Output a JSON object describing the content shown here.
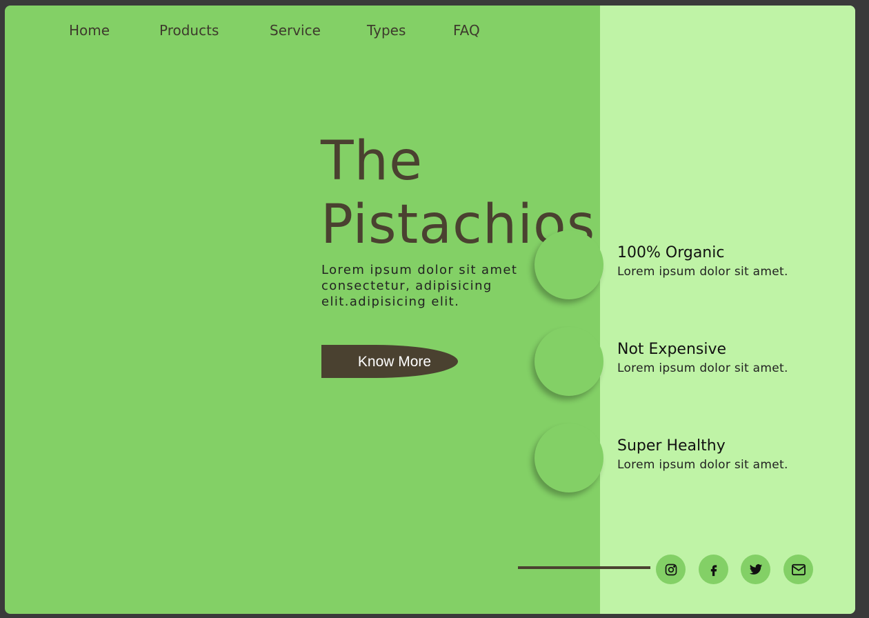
{
  "nav": {
    "items": [
      {
        "label": "Home"
      },
      {
        "label": "Products"
      },
      {
        "label": "Service"
      },
      {
        "label": "Types"
      },
      {
        "label": "FAQ"
      }
    ]
  },
  "hero": {
    "title_line1": "The",
    "title_line2": "Pistachios",
    "text": "Lorem ipsum dolor sit amet consectetur, adipisicing elit.adipisicing elit.",
    "cta_label": "Know More"
  },
  "features": [
    {
      "title": "100% Organic",
      "desc": "Lorem ipsum dolor sit amet."
    },
    {
      "title": "Not Expensive",
      "desc": "Lorem ipsum dolor sit amet."
    },
    {
      "title": "Super Healthy",
      "desc": "Lorem ipsum dolor sit amet."
    }
  ],
  "social": {
    "icons": [
      "instagram-icon",
      "facebook-icon",
      "twitter-icon",
      "mail-icon"
    ]
  },
  "colors": {
    "primary_green": "#83d066",
    "light_green": "#bff3a6",
    "dark_brown": "#4a4130"
  }
}
